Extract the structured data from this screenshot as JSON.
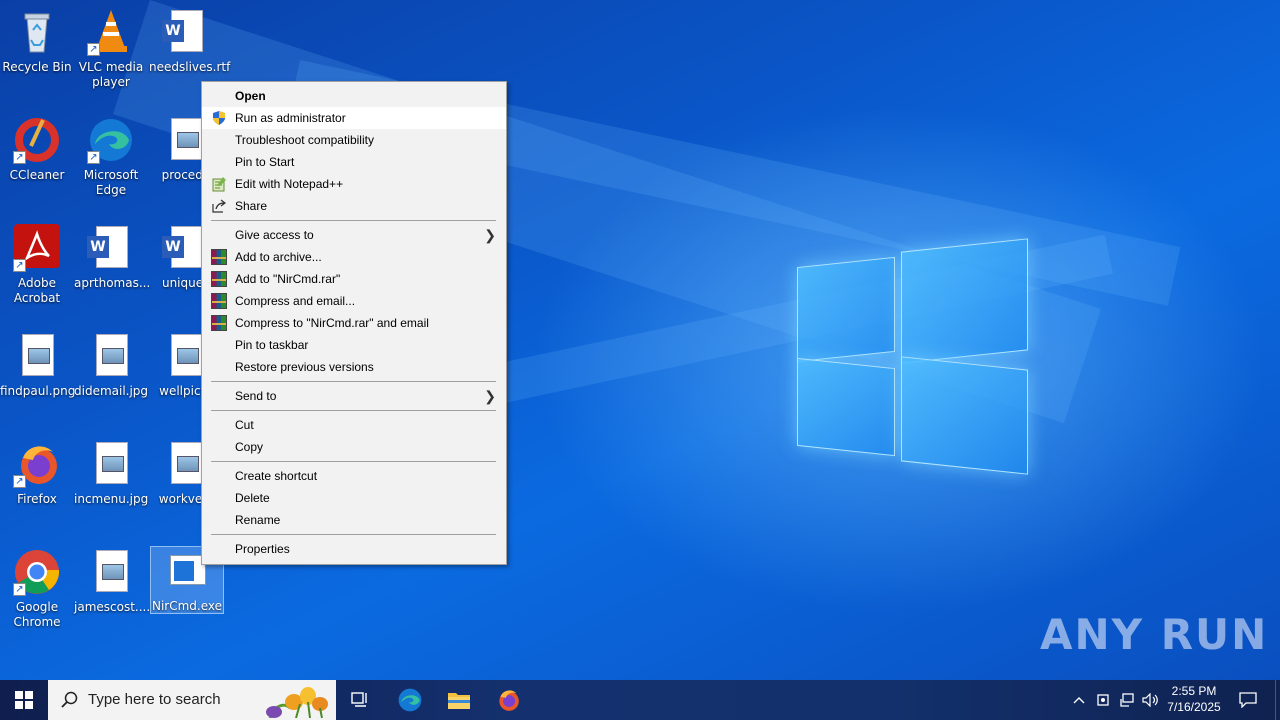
{
  "desktop": {
    "icons": [
      {
        "label": "Recycle Bin"
      },
      {
        "label": "VLC media player"
      },
      {
        "label": "needslives.rtf"
      },
      {
        "label": "CCleaner"
      },
      {
        "label": "Microsoft Edge"
      },
      {
        "label": "procedu"
      },
      {
        "label": "Adobe Acrobat"
      },
      {
        "label": "aprthomas..."
      },
      {
        "label": "uniquex"
      },
      {
        "label": "findpaul.png"
      },
      {
        "label": "didemail.jpg"
      },
      {
        "label": "wellpictu"
      },
      {
        "label": "Firefox"
      },
      {
        "label": "incmenu.jpg"
      },
      {
        "label": "workvehi"
      },
      {
        "label": "Google Chrome"
      },
      {
        "label": "jamescost...."
      },
      {
        "label": "NirCmd.exe"
      }
    ]
  },
  "context_menu": {
    "items": [
      {
        "label": "Open"
      },
      {
        "label": "Run as administrator"
      },
      {
        "label": "Troubleshoot compatibility"
      },
      {
        "label": "Pin to Start"
      },
      {
        "label": "Edit with Notepad++"
      },
      {
        "label": "Share"
      },
      {
        "label": "Give access to"
      },
      {
        "label": "Add to archive..."
      },
      {
        "label": "Add to \"NirCmd.rar\""
      },
      {
        "label": "Compress and email..."
      },
      {
        "label": "Compress to \"NirCmd.rar\" and email"
      },
      {
        "label": "Pin to taskbar"
      },
      {
        "label": "Restore previous versions"
      },
      {
        "label": "Send to"
      },
      {
        "label": "Cut"
      },
      {
        "label": "Copy"
      },
      {
        "label": "Create shortcut"
      },
      {
        "label": "Delete"
      },
      {
        "label": "Rename"
      },
      {
        "label": "Properties"
      }
    ]
  },
  "taskbar": {
    "search_placeholder": "Type here to search",
    "time": "2:55 PM",
    "date": "7/16/2025"
  },
  "watermark": "ANY RUN",
  "colors": {
    "menu_bg": "#f2f2f2",
    "menu_hover": "#ffffff",
    "taskbar": "#14306e"
  }
}
